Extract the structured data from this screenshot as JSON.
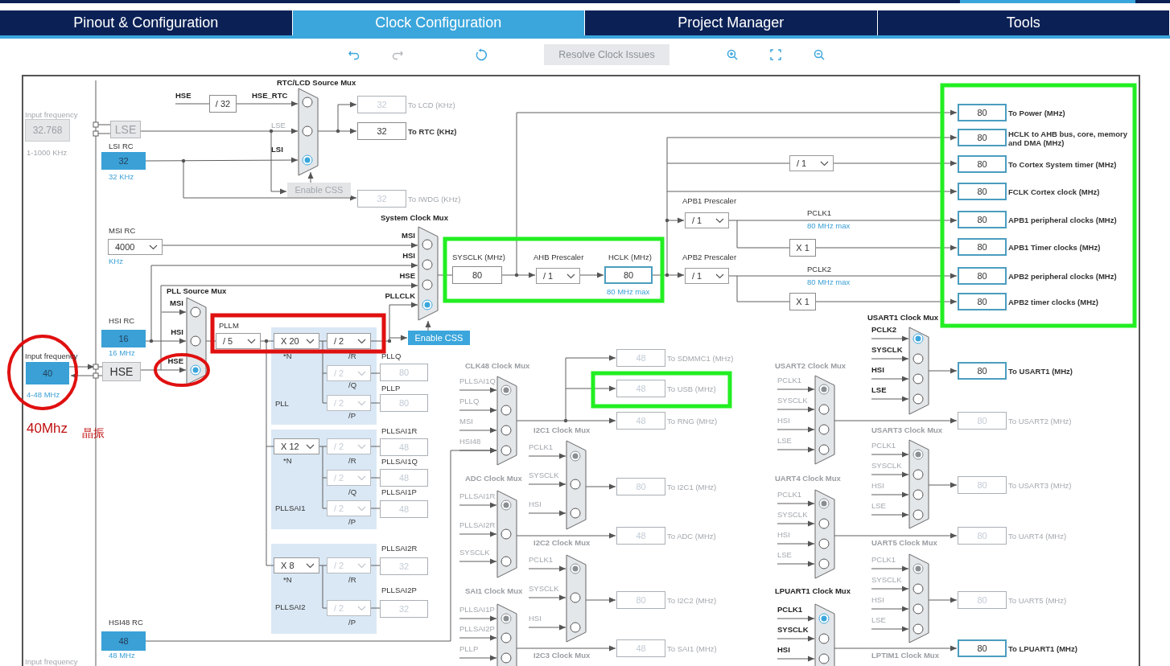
{
  "tabs": [
    {
      "label": "Pinout & Configuration",
      "selected": false
    },
    {
      "label": "Clock Configuration",
      "selected": true
    },
    {
      "label": "Project Manager",
      "selected": false
    },
    {
      "label": "Tools",
      "selected": false
    }
  ],
  "toolbar": {
    "tools": [
      {
        "kind": "undo",
        "enabled": true
      },
      {
        "kind": "redo",
        "enabled": false
      },
      {
        "kind": "reset",
        "enabled": true
      },
      {
        "kind": "resolve",
        "label": "Resolve Clock Issues",
        "enabled": false
      },
      {
        "kind": "zoom-in",
        "enabled": true
      },
      {
        "kind": "fit",
        "enabled": true
      },
      {
        "kind": "zoom-out",
        "enabled": true
      }
    ]
  },
  "labels": [
    {
      "text": "Input frequency",
      "kind": "grey"
    },
    {
      "text": "1-1000 KHz",
      "kind": "grey"
    },
    {
      "text": "LSI RC",
      "kind": "dark"
    },
    {
      "text": "32 KHz",
      "kind": "blue"
    },
    {
      "text": "HSE",
      "kind": "bold"
    },
    {
      "text": "HSE_RTC",
      "kind": "bold"
    },
    {
      "text": "LSE",
      "kind": "grey"
    },
    {
      "text": "LSI",
      "kind": "bold"
    },
    {
      "text": "MSI RC",
      "kind": "dark"
    },
    {
      "text": "KHz",
      "kind": "blue"
    },
    {
      "text": "HSI RC",
      "kind": "dark"
    },
    {
      "text": "16 MHz",
      "kind": "blue"
    },
    {
      "text": "Input frequency",
      "kind": "dark"
    },
    {
      "text": "4-48 MHz",
      "kind": "blue"
    },
    {
      "text": "HSI48 RC",
      "kind": "dark"
    },
    {
      "text": "48 MHz",
      "kind": "blue"
    },
    {
      "text": "Input frequency",
      "kind": "grey"
    },
    {
      "text": "PLLM",
      "kind": "dark"
    },
    {
      "text": "*N",
      "kind": "dark"
    },
    {
      "text": "/R",
      "kind": "dark"
    },
    {
      "text": "/Q",
      "kind": "dark"
    },
    {
      "text": "PLL",
      "kind": "dark"
    },
    {
      "text": "/P",
      "kind": "dark"
    },
    {
      "text": "PLLQ",
      "kind": "dark"
    },
    {
      "text": "PLLP",
      "kind": "dark"
    },
    {
      "text": "*N",
      "kind": "dark"
    },
    {
      "text": "/R",
      "kind": "dark"
    },
    {
      "text": "/Q",
      "kind": "dark"
    },
    {
      "text": "PLLSAI1",
      "kind": "dark"
    },
    {
      "text": "/P",
      "kind": "dark"
    },
    {
      "text": "PLLSAI1R",
      "kind": "dark"
    },
    {
      "text": "PLLSAI1Q",
      "kind": "dark"
    },
    {
      "text": "PLLSAI1P",
      "kind": "dark"
    },
    {
      "text": "*N",
      "kind": "dark"
    },
    {
      "text": "/R",
      "kind": "dark"
    },
    {
      "text": "PLLSAI2",
      "kind": "dark"
    },
    {
      "text": "/P",
      "kind": "dark"
    },
    {
      "text": "PLLSAI2R",
      "kind": "dark"
    },
    {
      "text": "PLLSAI2P",
      "kind": "dark"
    },
    {
      "text": "SYSCLK (MHz)",
      "kind": "dark"
    },
    {
      "text": "AHB Prescaler",
      "kind": "dark"
    },
    {
      "text": "HCLK (MHz)",
      "kind": "dark"
    },
    {
      "text": "80 MHz max",
      "kind": "blue"
    },
    {
      "text": "APB1 Prescaler",
      "kind": "dark"
    },
    {
      "text": "PCLK1",
      "kind": "dark"
    },
    {
      "text": "80 MHz max",
      "kind": "blue"
    },
    {
      "text": "APB2 Prescaler",
      "kind": "dark"
    },
    {
      "text": "PCLK2",
      "kind": "dark"
    },
    {
      "text": "80 MHz max",
      "kind": "blue"
    },
    {
      "text": "I2C3 Clock Mux",
      "kind": "greybold"
    },
    {
      "text": "LPTIM1 Clock Mux",
      "kind": "greybold"
    }
  ],
  "fields": [
    {
      "kind": "input",
      "value": "32.768",
      "enabled": false,
      "highlighted": false
    },
    {
      "kind": "box",
      "value": "/ 32",
      "enabled": true,
      "highlighted": false
    },
    {
      "kind": "box",
      "value": "80",
      "enabled": true,
      "highlighted": false
    },
    {
      "kind": "box",
      "value": "80",
      "enabled": true,
      "highlighted": true
    },
    {
      "kind": "box",
      "value": "X 1",
      "enabled": true,
      "highlighted": false
    },
    {
      "kind": "box",
      "value": "X 1",
      "enabled": true,
      "highlighted": false
    },
    {
      "kind": "box",
      "value": "80",
      "enabled": false,
      "highlighted": false
    },
    {
      "kind": "box",
      "value": "80",
      "enabled": false,
      "highlighted": false
    },
    {
      "kind": "box",
      "value": "48",
      "enabled": false,
      "highlighted": false
    },
    {
      "kind": "box",
      "value": "48",
      "enabled": false,
      "highlighted": false
    },
    {
      "kind": "box",
      "value": "48",
      "enabled": false,
      "highlighted": false
    },
    {
      "kind": "box",
      "value": "32",
      "enabled": false,
      "highlighted": false
    },
    {
      "kind": "box",
      "value": "32",
      "enabled": false,
      "highlighted": false
    }
  ],
  "sources": [
    {
      "value": "32"
    },
    {
      "value": "16"
    },
    {
      "value": "40"
    },
    {
      "value": "48"
    }
  ],
  "blocks": [
    {
      "label": "LSE",
      "enabled": false
    },
    {
      "label": "HSE",
      "enabled": true
    }
  ],
  "dropdowns": [
    {
      "value": "4000",
      "enabled": true
    },
    {
      "value": "/ 5",
      "enabled": true
    },
    {
      "value": "X 20",
      "enabled": true
    },
    {
      "value": "/ 2",
      "enabled": true
    },
    {
      "value": "/ 2",
      "enabled": false
    },
    {
      "value": "/ 2",
      "enabled": false
    },
    {
      "value": "X 12",
      "enabled": true
    },
    {
      "value": "/ 2",
      "enabled": false
    },
    {
      "value": "/ 2",
      "enabled": false
    },
    {
      "value": "/ 2",
      "enabled": false
    },
    {
      "value": "X 8",
      "enabled": true
    },
    {
      "value": "/ 2",
      "enabled": false
    },
    {
      "value": "/ 2",
      "enabled": false
    },
    {
      "value": "/ 1",
      "enabled": true
    },
    {
      "value": "/ 1",
      "enabled": true
    },
    {
      "value": "/ 1",
      "enabled": true
    },
    {
      "value": "/ 1",
      "enabled": true
    }
  ],
  "buttons": [
    {
      "label": "Enable CSS",
      "enabled": false
    },
    {
      "label": "Enable CSS",
      "enabled": true
    }
  ],
  "outputs": [
    {
      "value": "32",
      "label": "To LCD (KHz)",
      "enabled": false,
      "highlighted": false
    },
    {
      "value": "32",
      "label": "To RTC (KHz)",
      "enabled": true,
      "highlighted": false
    },
    {
      "value": "32",
      "label": "To IWDG (KHz)",
      "enabled": false,
      "highlighted": false
    },
    {
      "value": "80",
      "label": "To Power (MHz)",
      "enabled": true,
      "highlighted": true
    },
    {
      "value": "80",
      "label": "HCLK to AHB bus, core, memory and DMA (MHz)",
      "enabled": true,
      "highlighted": true
    },
    {
      "value": "80",
      "label": "To Cortex System timer (MHz)",
      "enabled": true,
      "highlighted": true
    },
    {
      "value": "80",
      "label": "FCLK Cortex clock (MHz)",
      "enabled": true,
      "highlighted": true
    },
    {
      "value": "80",
      "label": "APB1 peripheral clocks (MHz)",
      "enabled": true,
      "highlighted": true
    },
    {
      "value": "80",
      "label": "APB1 Timer clocks (MHz)",
      "enabled": true,
      "highlighted": true
    },
    {
      "value": "80",
      "label": "APB2 peripheral clocks (MHz)",
      "enabled": true,
      "highlighted": true
    },
    {
      "value": "80",
      "label": "APB2 timer clocks (MHz)",
      "enabled": true,
      "highlighted": true
    },
    {
      "value": "48",
      "label": "To SDMMC1 (MHz)",
      "enabled": false,
      "highlighted": false
    },
    {
      "value": "48",
      "label": "To USB (MHz)",
      "enabled": false,
      "highlighted": false
    },
    {
      "value": "48",
      "label": "To RNG (MHz)",
      "enabled": false,
      "highlighted": false
    },
    {
      "value": "80",
      "label": "To I2C1 (MHz)",
      "enabled": false,
      "highlighted": false
    },
    {
      "value": "48",
      "label": "To ADC (MHz)",
      "enabled": false,
      "highlighted": false
    },
    {
      "value": "80",
      "label": "To I2C2 (MHz)",
      "enabled": false,
      "highlighted": false
    },
    {
      "value": "48",
      "label": "To SAI1 (MHz)",
      "enabled": false,
      "highlighted": false
    },
    {
      "value": "80",
      "label": "To USART1 (MHz)",
      "enabled": true,
      "highlighted": true
    },
    {
      "value": "80",
      "label": "To USART2 (MHz)",
      "enabled": false,
      "highlighted": false
    },
    {
      "value": "80",
      "label": "To USART3 (MHz)",
      "enabled": false,
      "highlighted": false
    },
    {
      "value": "80",
      "label": "To UART4 (MHz)",
      "enabled": false,
      "highlighted": false
    },
    {
      "value": "80",
      "label": "To UART5 (MHz)",
      "enabled": false,
      "highlighted": false
    },
    {
      "value": "80",
      "label": "To LPUART1 (MHz)",
      "enabled": true,
      "highlighted": true
    }
  ],
  "muxes": [
    {
      "title": "RTC/LCD Source Mux",
      "enabled": true,
      "inputs": [
        {
          "selected": false
        },
        {
          "selected": false
        },
        {
          "selected": true
        }
      ]
    },
    {
      "title": "System Clock Mux",
      "enabled": true,
      "inputs": [
        {
          "label": "MSI",
          "selected": false
        },
        {
          "label": "HSI",
          "selected": false
        },
        {
          "label": "HSE",
          "selected": false
        },
        {
          "label": "PLLCLK",
          "selected": true
        }
      ]
    },
    {
      "title": "PLL Source Mux",
      "enabled": true,
      "inputs": [
        {
          "label": "MSI",
          "selected": false
        },
        {
          "label": "HSI",
          "selected": false
        },
        {
          "label": "HSE",
          "selected": true
        }
      ]
    },
    {
      "title": "CLK48 Clock Mux",
      "enabled": false,
      "inputs": [
        {
          "label": "PLLSAI1Q",
          "selected": true
        },
        {
          "label": "PLLQ",
          "selected": false
        },
        {
          "label": "MSI",
          "selected": false
        },
        {
          "label": "HSI48",
          "selected": false
        }
      ]
    },
    {
      "title": "I2C1 Clock Mux",
      "enabled": false,
      "inputs": [
        {
          "label": "PCLK1",
          "selected": true
        },
        {
          "label": "SYSCLK",
          "selected": false
        },
        {
          "label": "HSI",
          "selected": false
        }
      ]
    },
    {
      "title": "ADC Clock Mux",
      "enabled": false,
      "inputs": [
        {
          "label": "PLLSAI1R",
          "selected": true
        },
        {
          "label": "PLLSAI2R",
          "selected": false
        },
        {
          "label": "SYSCLK",
          "selected": false
        }
      ]
    },
    {
      "title": "I2C2 Clock Mux",
      "enabled": false,
      "inputs": [
        {
          "label": "PCLK1",
          "selected": true
        },
        {
          "label": "SYSCLK",
          "selected": false
        },
        {
          "label": "HSI",
          "selected": false
        }
      ]
    },
    {
      "title": "SAI1 Clock Mux",
      "enabled": false,
      "inputs": [
        {
          "label": "PLLSAI1P",
          "selected": true
        },
        {
          "label": "PLLSAI2P",
          "selected": false
        },
        {
          "label": "PLLP",
          "selected": false
        }
      ]
    },
    {
      "title": "USART1 Clock Mux",
      "enabled": true,
      "inputs": [
        {
          "label": "PCLK2",
          "selected": true
        },
        {
          "label": "SYSCLK",
          "selected": false
        },
        {
          "label": "HSI",
          "selected": false
        },
        {
          "label": "LSE",
          "selected": false
        }
      ]
    },
    {
      "title": "USART2 Clock Mux",
      "enabled": false,
      "inputs": [
        {
          "label": "PCLK1",
          "selected": true
        },
        {
          "label": "SYSCLK",
          "selected": false
        },
        {
          "label": "HSI",
          "selected": false
        },
        {
          "label": "LSE",
          "selected": false
        }
      ]
    },
    {
      "title": "USART3 Clock Mux",
      "enabled": false,
      "inputs": [
        {
          "label": "PCLK1",
          "selected": true
        },
        {
          "label": "SYSCLK",
          "selected": false
        },
        {
          "label": "HSI",
          "selected": false
        },
        {
          "label": "LSE",
          "selected": false
        }
      ]
    },
    {
      "title": "UART4 Clock Mux",
      "enabled": false,
      "inputs": [
        {
          "label": "PCLK1",
          "selected": true
        },
        {
          "label": "SYSCLK",
          "selected": false
        },
        {
          "label": "HSI",
          "selected": false
        },
        {
          "label": "LSE",
          "selected": false
        }
      ]
    },
    {
      "title": "UART5 Clock Mux",
      "enabled": false,
      "inputs": [
        {
          "label": "PCLK1",
          "selected": true
        },
        {
          "label": "SYSCLK",
          "selected": false
        },
        {
          "label": "HSI",
          "selected": false
        },
        {
          "label": "LSE",
          "selected": false
        }
      ]
    },
    {
      "title": "LPUART1 Clock Mux",
      "enabled": true,
      "inputs": [
        {
          "label": "PCLK1",
          "selected": true
        },
        {
          "label": "SYSCLK",
          "selected": false
        },
        {
          "label": "HSI",
          "selected": false
        }
      ]
    }
  ],
  "annotations": {
    "marks": [
      {
        "kind": "ellipse",
        "color": "#e01010"
      },
      {
        "kind": "ellipse",
        "color": "#e01010"
      },
      {
        "kind": "rectangle",
        "color": "#e01010"
      },
      {
        "kind": "rectangle",
        "color": "#22ee22"
      },
      {
        "kind": "rectangle",
        "color": "#22ee22"
      },
      {
        "kind": "rectangle",
        "color": "#22ee22"
      }
    ],
    "note": "40Mhz",
    "note_cn": "晶振"
  }
}
